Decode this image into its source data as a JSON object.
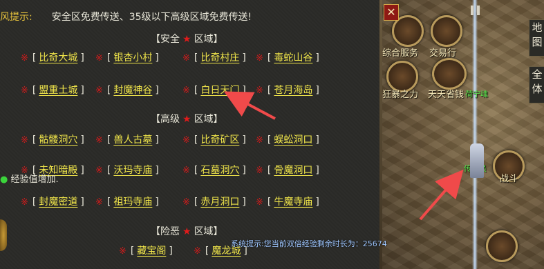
{
  "tip": {
    "label": "风提示:",
    "message": "安全区免费传送、35级以下高级区域免费传送!"
  },
  "sections": {
    "safe": {
      "left": "【安全",
      "right": "区域】"
    },
    "advanced": {
      "left": "【高级",
      "right": "区域】"
    },
    "danger": {
      "left": "【险恶",
      "right": "区域】"
    }
  },
  "rows": [
    [
      "比奇大城",
      "银杏小村",
      "比奇村庄",
      "毒蛇山谷"
    ],
    [
      "盟重土城",
      "封魔神谷",
      "白日天门",
      "苍月海岛"
    ],
    [
      "骷髅洞穴",
      "兽人古墓",
      "比奇矿区",
      "蜈蚣洞口"
    ],
    [
      "未知暗殿",
      "沃玛寺庙",
      "石墓洞穴",
      "骨魔洞口"
    ],
    [
      "封魔密道",
      "祖玛寺庙",
      "赤月洞口",
      "牛魔寺庙"
    ],
    [
      "藏宝阁",
      "魔龙城"
    ]
  ],
  "symbols": {
    "mark": "※",
    "star": "★",
    "open": "[",
    "close": "]"
  },
  "exp_text": "经验值增加.",
  "system_message": "系统提示:您当前双倍经验剩余时长为：25674",
  "scene": {
    "buttons": [
      "综合服务",
      "交易行",
      "狂暴之力",
      "天天省钱"
    ],
    "side_chars": [
      "地",
      "图",
      "全",
      "体"
    ],
    "npc_names": [
      "荷宁魂",
      "传送员"
    ],
    "battle_label": "战斗",
    "close_glyph": "✕"
  },
  "colors": {
    "place": "#f0e54a",
    "mark": "#d21b1b",
    "star": "#e01b1b",
    "label": "#e6c23c",
    "arrow": "#f04a4a"
  }
}
